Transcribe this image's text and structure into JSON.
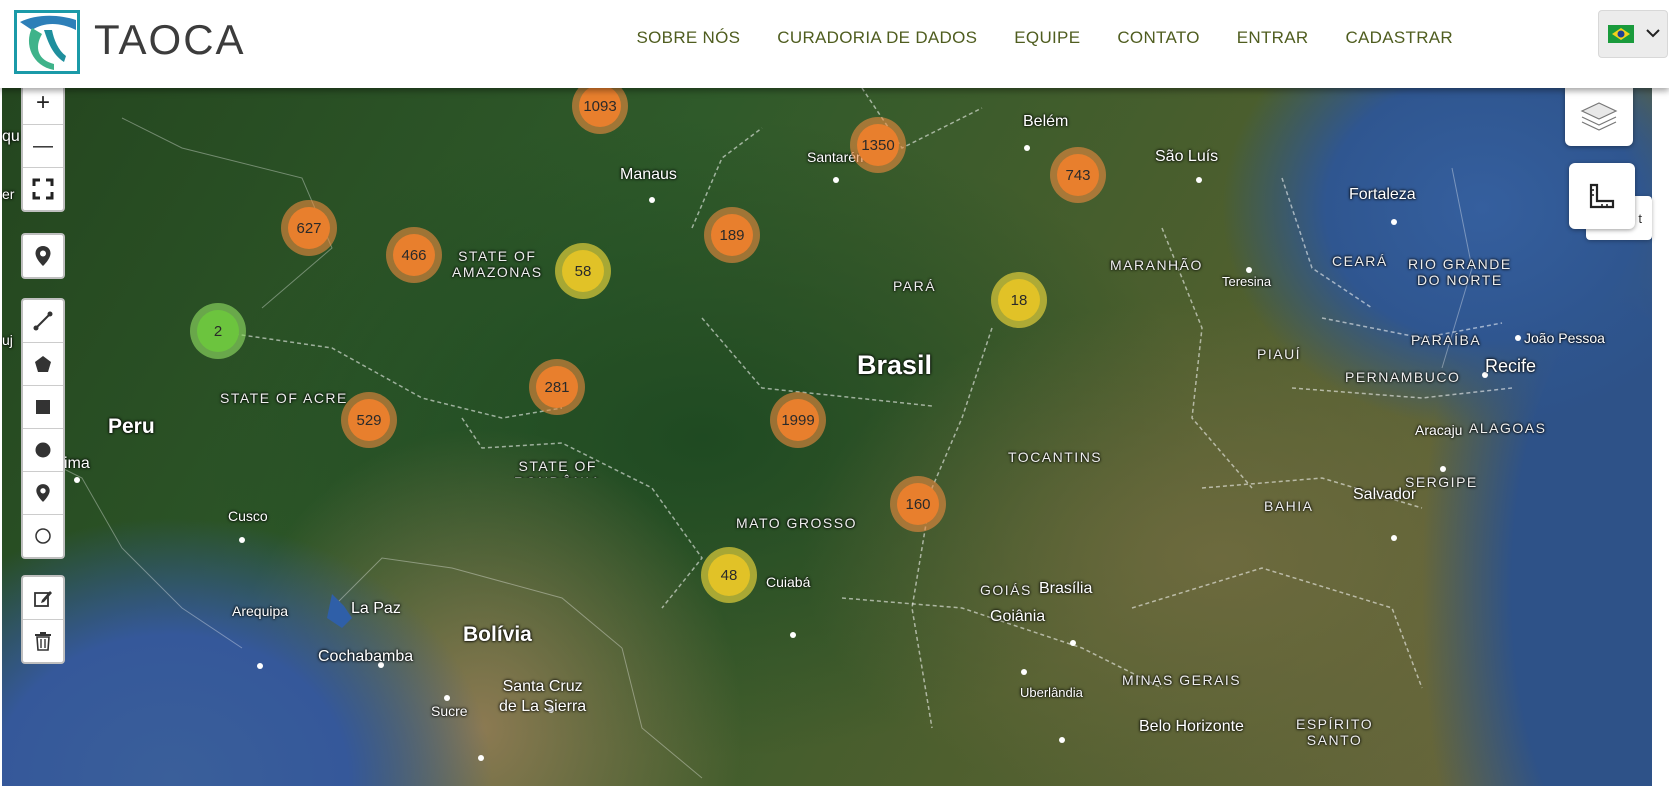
{
  "brand": {
    "name": "TAOCA"
  },
  "nav": {
    "items": [
      "SOBRE NÓS",
      "CURADORIA DE DADOS",
      "EQUIPE",
      "CONTATO",
      "ENTRAR",
      "CADASTRAR"
    ]
  },
  "language": {
    "flag": "brazil-flag-icon"
  },
  "map": {
    "controls": {
      "zoom_in": "+",
      "zoom_out": "—",
      "ruler_tooltip_fragment": "t"
    },
    "labels": {
      "manaus": "Manaus",
      "santarem": "Santarém",
      "belem": "Belém",
      "sao_luis": "São Luís",
      "fortaleza": "Fortaleza",
      "teresina": "Teresina",
      "joao_pessoa": "João Pessoa",
      "recife": "Recife",
      "aracaju": "Aracaju",
      "salvador": "Salvador",
      "brasilia": "Brasília",
      "goiania": "Goiânia",
      "uberlandia": "Uberlândia",
      "belo_horizonte": "Belo Horizonte",
      "cuiaba": "Cuiabá",
      "la_paz": "La Paz",
      "arequipa": "Arequipa",
      "cochabamba": "Cochabamba",
      "santa_cruz": "Santa Cruz\nde La Sierra",
      "sucre": "Sucre",
      "cusco": "Cusco",
      "lima": "ima",
      "top_left_fragment": "qu",
      "left_fragment": "er",
      "left_fragment2": "uj",
      "peru": "Peru",
      "bolivia": "Bolívia",
      "brasil": "Brasil",
      "amazonas": "STATE OF\nAMAZONAS",
      "acre": "STATE OF ACRE",
      "rondonia": "STATE OF\nRONDÔNIA",
      "para": "PARÁ",
      "maranhao": "MARANHÃO",
      "ceara": "CEARÁ",
      "rio_grande_norte": "RIO GRANDE\nDO NORTE",
      "paraiba": "PARAÍBA",
      "piaui": "PIAUÍ",
      "pernambuco": "PERNAMBUCO",
      "alagoas": "ALAGOAS",
      "sergipe": "SERGIPE",
      "tocantins": "TOCANTINS",
      "bahia": "BAHIA",
      "mato_grosso": "MATO GROSSO",
      "goias": "GOIÁS",
      "minas_gerais": "MINAS GERAIS",
      "espirito_santo": "ESPÍRITO\nSANTO"
    },
    "clusters": [
      {
        "count": "1093",
        "level": "orange"
      },
      {
        "count": "1350",
        "level": "orange"
      },
      {
        "count": "743",
        "level": "orange"
      },
      {
        "count": "627",
        "level": "orange"
      },
      {
        "count": "466",
        "level": "orange"
      },
      {
        "count": "58",
        "level": "yellow"
      },
      {
        "count": "189",
        "level": "orange"
      },
      {
        "count": "18",
        "level": "yellow"
      },
      {
        "count": "2",
        "level": "green"
      },
      {
        "count": "281",
        "level": "orange"
      },
      {
        "count": "529",
        "level": "orange"
      },
      {
        "count": "1999",
        "level": "orange"
      },
      {
        "count": "160",
        "level": "orange"
      },
      {
        "count": "48",
        "level": "yellow"
      }
    ]
  },
  "colors": {
    "nav_text": "#4f5d1f",
    "cluster_orange": "#e87f2d",
    "cluster_yellow": "#e1c227",
    "cluster_green": "#6cc43e"
  }
}
